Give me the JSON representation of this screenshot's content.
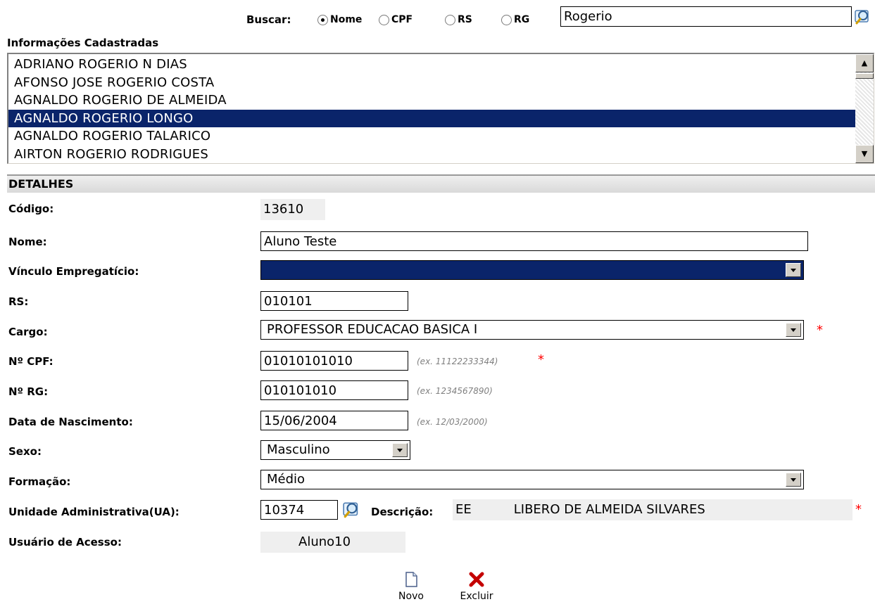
{
  "search": {
    "label": "Buscar:",
    "options": [
      "Nome",
      "CPF",
      "RS",
      "RG"
    ],
    "selected": "Nome",
    "value": "Rogerio"
  },
  "list": {
    "title": "Informações Cadastradas",
    "items": [
      "ADRIANO ROGERIO N DIAS",
      "AFONSO JOSE ROGERIO COSTA",
      "AGNALDO ROGERIO DE ALMEIDA",
      "AGNALDO ROGERIO LONGO",
      "AGNALDO ROGERIO TALARICO",
      "AIRTON ROGERIO RODRIGUES"
    ],
    "selected_index": 3
  },
  "details": {
    "header": "DETALHES",
    "codigo": {
      "label": "Código:",
      "value": "13610"
    },
    "nome": {
      "label": "Nome:",
      "value": "Aluno Teste"
    },
    "vinculo": {
      "label": "Vínculo Empregatício:",
      "value": ""
    },
    "rs": {
      "label": "RS:",
      "value": "010101"
    },
    "cargo": {
      "label": "Cargo:",
      "value": "PROFESSOR EDUCACAO BASICA I"
    },
    "cpf": {
      "label": "Nº CPF:",
      "value": "01010101010",
      "hint": "(ex. 11122233344)"
    },
    "rg": {
      "label": "Nº RG:",
      "value": "010101010",
      "hint": "(ex. 1234567890)"
    },
    "nascimento": {
      "label": "Data de Nascimento:",
      "value": "15/06/2004",
      "hint": "(ex. 12/03/2000)"
    },
    "sexo": {
      "label": "Sexo:",
      "value": "Masculino"
    },
    "formacao": {
      "label": "Formação:",
      "value": "Médio"
    },
    "ua": {
      "label": "Unidade Administrativa(UA):",
      "value": "10374",
      "descricao_label": "Descrição:",
      "descricao_prefix": "EE",
      "descricao_value": "LIBERO DE ALMEIDA SILVARES"
    },
    "usuario": {
      "label": "Usuário de Acesso:",
      "value": "Aluno10"
    },
    "required_mark": "*"
  },
  "actions": {
    "novo": "Novo",
    "excluir": "Excluir"
  },
  "colors": {
    "selection": "#0a246a",
    "required": "#ff0000",
    "readonly_bg": "#efefef"
  }
}
